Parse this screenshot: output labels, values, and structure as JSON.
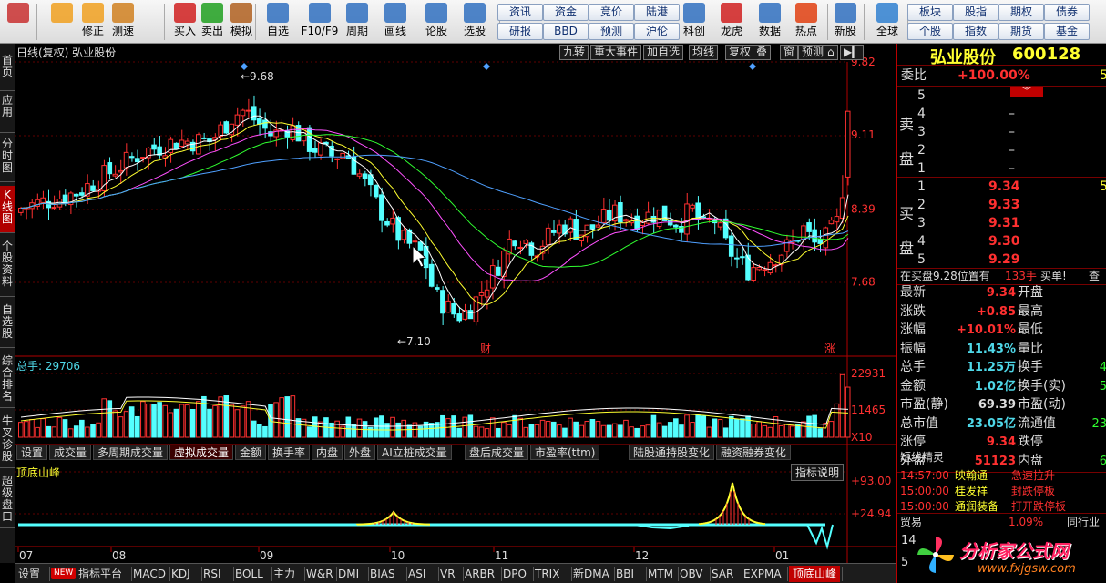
{
  "toolbar": {
    "buttons": [
      {
        "label": "",
        "icon": "windows-grid-icon",
        "color": "#c83030"
      },
      {
        "label": "",
        "icon": "back-arrow-icon",
        "color": "#f0a020"
      },
      {
        "label": "修正",
        "icon": "up-down-arrow-icon",
        "color": "#f0a020"
      },
      {
        "label": "测速",
        "icon": "clock-icon",
        "color": "#d08020"
      },
      {
        "label": "买入",
        "icon": "buy-icon",
        "color": "#d02020"
      },
      {
        "label": "卖出",
        "icon": "sell-icon",
        "color": "#20a020"
      },
      {
        "label": "模拟",
        "icon": "hammer-icon",
        "color": "#b06020"
      },
      {
        "label": "自选",
        "icon": "star-icon",
        "color": "#3070c0"
      },
      {
        "label": "F10/F9",
        "icon": "f10-icon",
        "color": "#3070c0"
      },
      {
        "label": "周期",
        "icon": "cycle-icon",
        "color": "#3070c0"
      },
      {
        "label": "画线",
        "icon": "pencil-icon",
        "color": "#3070c0"
      },
      {
        "label": "论股",
        "icon": "forum-icon",
        "color": "#3070c0"
      },
      {
        "label": "选股",
        "icon": "stock-pick-icon",
        "color": "#3070c0"
      }
    ],
    "small_buttons_a": [
      "资讯",
      "资金",
      "竞价",
      "陆港",
      "研报",
      "BBD",
      "预测",
      "沪伦"
    ],
    "buttons_b": [
      {
        "label": "科创",
        "icon": "chart-icon",
        "color": "#3070c0"
      },
      {
        "label": "龙虎",
        "icon": "dragon-icon",
        "color": "#d02020"
      },
      {
        "label": "数据",
        "icon": "pe-icon",
        "color": "#3070c0"
      },
      {
        "label": "热点",
        "icon": "hot-icon",
        "color": "#e04010"
      },
      {
        "label": "新股",
        "icon": "new-stock-icon",
        "color": "#3070c0"
      },
      {
        "label": "全球",
        "icon": "globe-icon",
        "color": "#3080d0"
      }
    ],
    "small_buttons_c": [
      "板块",
      "股指",
      "期权",
      "债券",
      "个股",
      "指数",
      "期货",
      "基金"
    ]
  },
  "left_tabs": [
    {
      "label": "首页"
    },
    {
      "label": "应用"
    },
    {
      "label": "分时图"
    },
    {
      "label": "K线图"
    },
    {
      "label": "个股资料"
    },
    {
      "label": "自选股"
    },
    {
      "label": "综合排名"
    },
    {
      "label": "牛叉诊股"
    },
    {
      "label": "超级盘口"
    }
  ],
  "chart_header": {
    "title": "日线(复权) 弘业股份",
    "buttons": [
      "九转",
      "重大事件",
      "加自选",
      "均线",
      "复权",
      "叠",
      "窗",
      "预测"
    ]
  },
  "price_axis": {
    "labels": [
      "9.82",
      "9.11",
      "8.39",
      "7.68"
    ]
  },
  "price_annotations": {
    "high": "9.68",
    "low": "7.10",
    "event1": "财",
    "event2": "涨"
  },
  "volume": {
    "title": "总手: 29706",
    "axis": [
      "22931",
      "11465",
      "X10"
    ]
  },
  "indicator_tabs": [
    "设置",
    "成交量",
    "多周期成交量",
    "虚拟成交量",
    "金额",
    "换手率",
    "内盘",
    "外盘",
    "AI立桩成交量",
    "盘后成交量",
    "市盈率(ttm)",
    "陆股通持股变化",
    "融资融券变化"
  ],
  "indicator": {
    "title": "顶底山峰",
    "help": "指标说明",
    "axis": [
      "+93.00",
      "+24.94"
    ]
  },
  "time_axis": [
    "07",
    "08",
    "09",
    "10",
    "11",
    "12",
    "01"
  ],
  "bottom_tabs": [
    "设置",
    "NEW",
    "指标平台",
    "MACD",
    "KDJ",
    "RSI",
    "BOLL",
    "主力",
    "W&R",
    "DMI",
    "BIAS",
    "ASI",
    "VR",
    "ARBR",
    "DPO",
    "TRIX",
    "新DMA",
    "BBI",
    "MTM",
    "OBV",
    "SAR",
    "EXPMA",
    "顶底山峰"
  ],
  "quote": {
    "name": "弘业股份",
    "code": "600128",
    "weibi_label": "委比",
    "weibi": "+100.00%",
    "weibi_right": "5",
    "sell_label": "卖盘",
    "buy_label": "买盘",
    "sells": [
      {
        "n": "5",
        "price": "",
        "vol": ""
      },
      {
        "n": "4",
        "price": "",
        "vol": "–"
      },
      {
        "n": "3",
        "price": "",
        "vol": "–"
      },
      {
        "n": "2",
        "price": "",
        "vol": "–"
      },
      {
        "n": "1",
        "price": "",
        "vol": "–"
      }
    ],
    "buys": [
      {
        "n": "1",
        "price": "9.34",
        "vol": "5"
      },
      {
        "n": "2",
        "price": "9.33",
        "vol": ""
      },
      {
        "n": "3",
        "price": "9.31",
        "vol": ""
      },
      {
        "n": "4",
        "price": "9.30",
        "vol": ""
      },
      {
        "n": "5",
        "price": "9.29",
        "vol": ""
      }
    ],
    "order_text": "在买盘9.28位置有",
    "order_num": "133手",
    "order_act": "买单!",
    "order_more": "查",
    "stats": [
      {
        "l": "最新",
        "v": "9.34",
        "vc": "red",
        "r": "开盘",
        "rv": ""
      },
      {
        "l": "涨跌",
        "v": "+0.85",
        "vc": "red",
        "r": "最高",
        "rv": ""
      },
      {
        "l": "涨幅",
        "v": "+10.01%",
        "vc": "red",
        "r": "最低",
        "rv": ""
      },
      {
        "l": "振幅",
        "v": "11.43%",
        "vc": "cy",
        "r": "量比",
        "rv": ""
      },
      {
        "l": "总手",
        "v": "11.25万",
        "vc": "cy",
        "r": "换手",
        "rv": "4"
      },
      {
        "l": "金额",
        "v": "1.02亿",
        "vc": "cy",
        "r": "换手(实)",
        "rv": "5"
      },
      {
        "l": "市盈(静)",
        "v": "69.39",
        "vc": "wh",
        "r": "市盈(动)",
        "rv": ""
      },
      {
        "l": "总市值",
        "v": "23.05亿",
        "vc": "cy",
        "r": "流通值",
        "rv": "23"
      },
      {
        "l": "涨停",
        "v": "9.34",
        "vc": "red",
        "r": "跌停",
        "rv": ""
      },
      {
        "l": "外盘",
        "v": "51123",
        "vc": "red",
        "r": "内盘",
        "rv": "6"
      }
    ],
    "elf_title": "短线精灵",
    "elf": [
      {
        "t": "14:57:00",
        "n": "映翰通",
        "a": "急速拉升"
      },
      {
        "t": "15:00:00",
        "n": "桂发祥",
        "a": "封跌停板"
      },
      {
        "t": "15:00:00",
        "n": "通润装备",
        "a": "打开跌停板"
      }
    ],
    "trade_label": "贸易",
    "trade_pct": "1.09%",
    "trade_right": "同行业",
    "last_num": "14",
    "last_num2": "5"
  },
  "watermark": {
    "text": "分析家公式网",
    "url": "www.fxjgsw.com"
  },
  "colors": {
    "up": "#ff3030",
    "down": "#54ffff",
    "ma5": "#ffffff",
    "ma10": "#ffff30",
    "ma20": "#ff50ff",
    "ma30": "#30ff30",
    "ma60": "#4fa0ff"
  }
}
